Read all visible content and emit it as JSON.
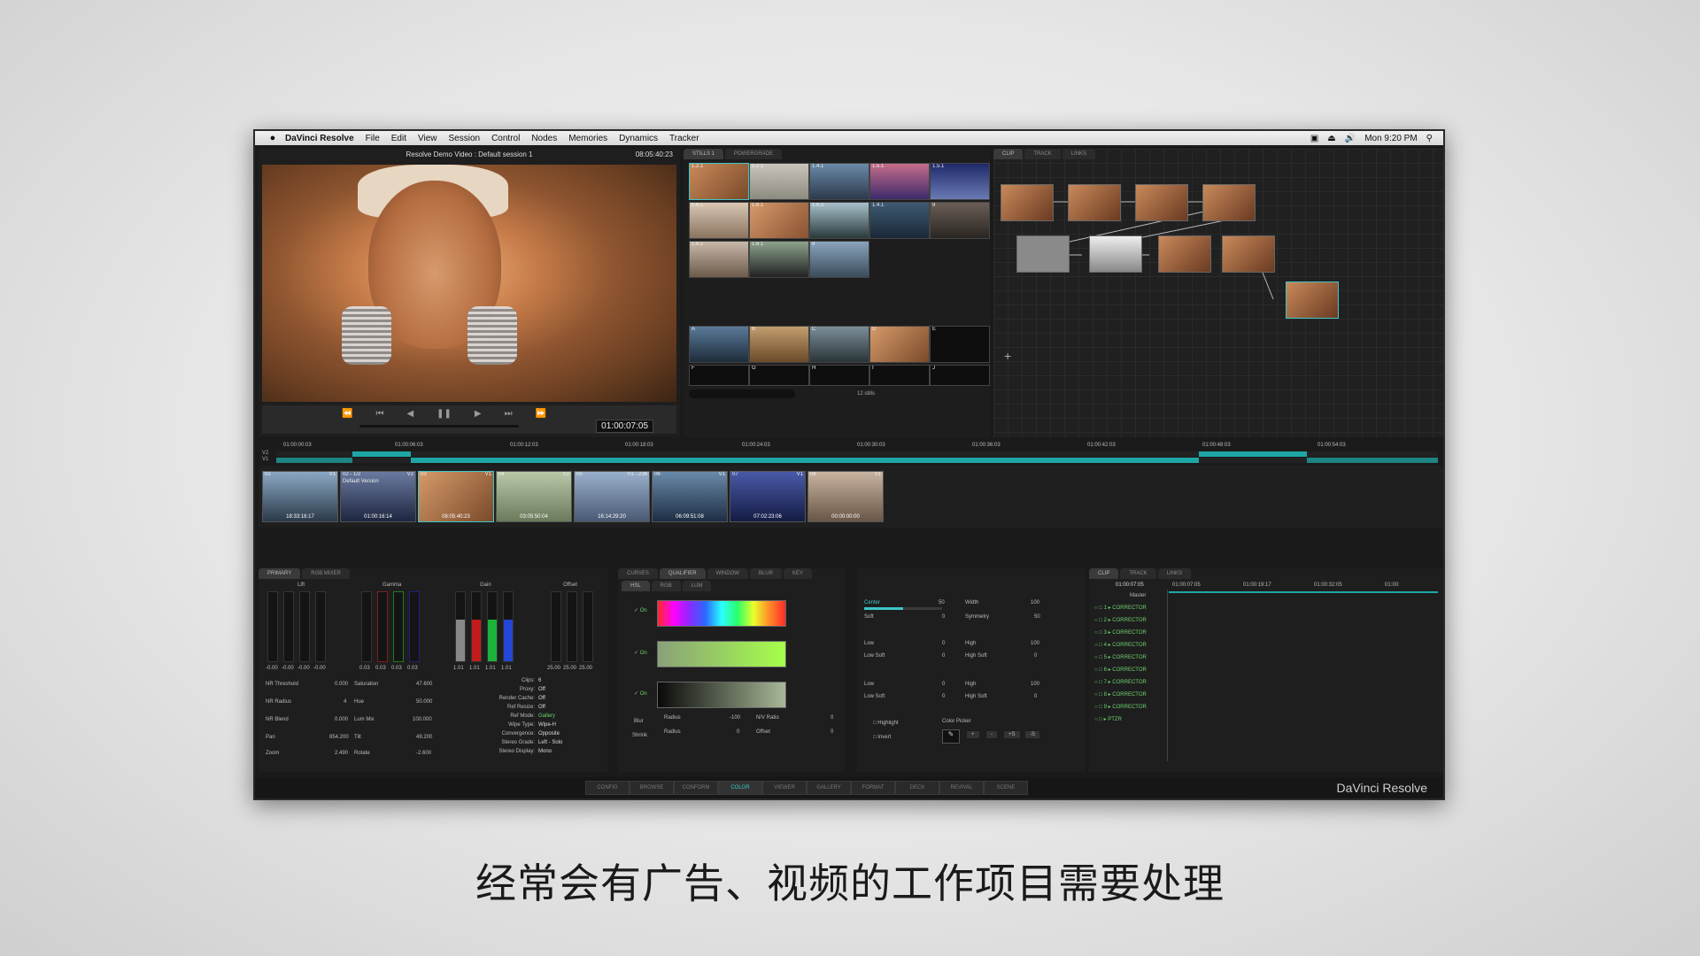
{
  "menubar": {
    "app": "DaVinci Resolve",
    "items": [
      "File",
      "Edit",
      "View",
      "Session",
      "Control",
      "Nodes",
      "Memories",
      "Dynamics",
      "Tracker"
    ],
    "clock": "Mon 9:20 PM"
  },
  "viewer": {
    "title": "Resolve Demo Video : Default session 1",
    "timecode": "08:05:40:23",
    "transport_timecode": "01:00:07:05"
  },
  "stills": {
    "tabs": [
      "STILLS 1",
      "POWERGRADE"
    ],
    "grid_labels": [
      "1.2.1",
      "1.2.1",
      "1.4.1",
      "1.5.1",
      "1.5.1",
      "1.6.1",
      "1.6.1",
      "1.6.2",
      "1.4.1",
      "9",
      "1.6.1",
      "1.6.1",
      "9"
    ],
    "memory_labels": [
      "A",
      "B",
      "C",
      "D",
      "E",
      "F",
      "G",
      "H",
      "I",
      "J"
    ],
    "count": "12 stills"
  },
  "nodes_panel": {
    "tabs": [
      "CLIP",
      "TRACK",
      "LINKS"
    ]
  },
  "timeline": {
    "ruler": [
      "01:00:00:03",
      "01:00:06:03",
      "01:00:12:03",
      "01:00:18:03",
      "01:00:24:03",
      "01:00:30:03",
      "01:00:36:03",
      "01:00:42:03",
      "01:00:48:03",
      "01:00:54:03"
    ],
    "tracks": [
      "V2",
      "V1"
    ]
  },
  "clips": [
    {
      "id": "01",
      "track": "V1",
      "tc": "18:33:16:17",
      "color": "#4f6a86"
    },
    {
      "id": "02 - 1/2",
      "track": "V2",
      "version": "Default Version",
      "tc": "01:00:16:14",
      "color": "#5d6a86"
    },
    {
      "id": "03",
      "track": "V1",
      "tc": "08:05:40:23",
      "color": "#b9774a"
    },
    {
      "id": "04",
      "track": "V2",
      "tc": "03:05:50:04",
      "color": "#8c9a72"
    },
    {
      "id": "05",
      "track": "V1 - 236",
      "tc": "16:14:29:20",
      "color": "#6e7e9a"
    },
    {
      "id": "06",
      "track": "V1",
      "tc": "06:09:51:08",
      "color": "#3f5a7a"
    },
    {
      "id": "07",
      "track": "V1",
      "tc": "07:02:23:06",
      "color": "#2c3d6a"
    },
    {
      "id": "08",
      "track": "V1",
      "tc": "00:00:00:00",
      "color": "#a08c78"
    }
  ],
  "primary": {
    "tabs": [
      "PRIMARY",
      "RGB MIXER"
    ],
    "wheels": [
      "Lift",
      "Gamma",
      "Gain",
      "Offset"
    ],
    "lift_vals": [
      "-0.00",
      "-0.00",
      "-0.00",
      "-0.00"
    ],
    "gamma_vals": [
      "0.03",
      "0.03",
      "0.03",
      "0.03"
    ],
    "gain_vals": [
      "1.01",
      "1.01",
      "1.01",
      "1.01"
    ],
    "offset_vals": [
      "25.00",
      "25.00",
      "25.00"
    ],
    "params_left": [
      [
        "NR Threshold",
        "0.000"
      ],
      [
        "NR Radius",
        "4"
      ],
      [
        "NR Blend",
        "0.000"
      ],
      [
        "Pan",
        "854.200"
      ],
      [
        "Zoom",
        "2.490"
      ]
    ],
    "params_mid": [
      [
        "Saturation",
        "47.600"
      ],
      [
        "Hue",
        "50.000"
      ],
      [
        "Lum Mix",
        "100.000"
      ],
      [
        "Tilt",
        "49.200"
      ],
      [
        "Rotate",
        "-2.600"
      ]
    ],
    "info": [
      [
        "Clips:",
        "6"
      ],
      [
        "Proxy:",
        "Off"
      ],
      [
        "Render Cache:",
        "Off"
      ],
      [
        "Ref Resize:",
        "Off"
      ],
      [
        "Ref Mode:",
        "Gallery"
      ],
      [
        "Wipe Type:",
        "Wipe-H"
      ],
      [
        "Convergence:",
        "Opposite"
      ],
      [
        "Stereo Grade:",
        "Left - Solo"
      ],
      [
        "Stereo Display:",
        "Mono"
      ]
    ]
  },
  "qualifier": {
    "tabs": [
      "CURVES",
      "QUALIFIER",
      "WINDOW",
      "BLUR",
      "KEY"
    ],
    "subtabs": [
      "HSL",
      "RGB",
      "LUM"
    ],
    "on_label": "On",
    "rows": [
      [
        [
          "Center",
          "50"
        ],
        [
          "Width",
          "100"
        ],
        [
          "Soft",
          "0"
        ],
        [
          "Symmetry",
          "50"
        ]
      ],
      [
        [
          "Low",
          "0"
        ],
        [
          "High",
          "100"
        ],
        [
          "Low Soft",
          "0"
        ],
        [
          "High Soft",
          "0"
        ]
      ],
      [
        [
          "Low",
          "0"
        ],
        [
          "High",
          "100"
        ],
        [
          "Low Soft",
          "0"
        ],
        [
          "High Soft",
          "0"
        ]
      ]
    ],
    "blur": [
      [
        "Blur",
        "Radius",
        "-100"
      ],
      [
        "",
        "N/V Ratio",
        "0"
      ],
      [
        "Shrink",
        "Radius",
        "0"
      ],
      [
        "",
        "Offset",
        "0"
      ]
    ],
    "options": [
      "Highlight",
      "Invert"
    ],
    "color_picker": "Color Picker",
    "picker_buttons": [
      "+",
      "-",
      "+S",
      "-S"
    ]
  },
  "nodelist": {
    "tabs": [
      "CLIP",
      "TRACK",
      "LINKS"
    ],
    "timecode": "01:00:07:05",
    "ruler": [
      "01:00:07:05",
      "01:00:19:17",
      "01:00:32:05",
      "01:00:"
    ],
    "master": "Master",
    "items": [
      "1",
      "2",
      "3",
      "4",
      "5",
      "6",
      "7",
      "8",
      "9"
    ],
    "item_name": "CORRECTOR",
    "last_item": "PTZR"
  },
  "pages": [
    "CONFIG",
    "BROWSE",
    "CONFORM",
    "COLOR",
    "VIEWER",
    "GALLERY",
    "FORMAT",
    "DECK",
    "REVIVAL",
    "SCENE"
  ],
  "active_page": "COLOR",
  "brand": "DaVinci Resolve",
  "caption": "经常会有广告、视频的工作项目需要处理",
  "colors": {
    "accent": "#3ec6c8",
    "timeline_bar": "#1fa6a6"
  }
}
